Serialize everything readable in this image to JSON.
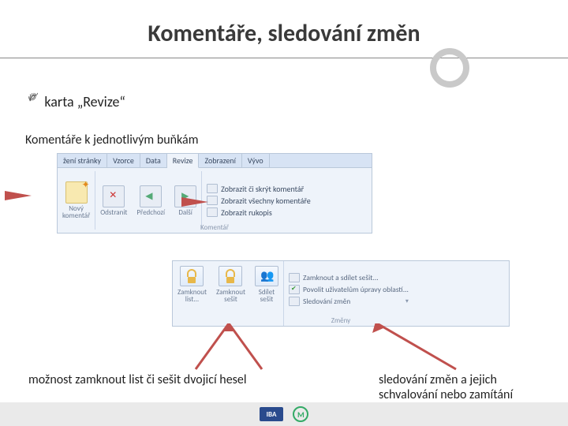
{
  "title": "Komentáře, sledování změn",
  "bullet": "karta „Revize“",
  "subhead": "Komentáře k jednotlivým buňkám",
  "ribbon1": {
    "tabs": [
      "žení stránky",
      "Vzorce",
      "Data",
      "Revize",
      "Zobrazení",
      "Vývo"
    ],
    "active_tab": "Revize",
    "buttons": {
      "new_comment": "Nový\nkomentář",
      "delete": "Odstranit",
      "prev": "Předchozí",
      "next": "Další"
    },
    "stack": {
      "show_hide": "Zobrazit či skrýt komentář",
      "show_all": "Zobrazit všechny komentáře",
      "show_ink": "Zobrazit rukopis"
    },
    "group_label": "Komentář"
  },
  "ribbon2": {
    "buttons": {
      "lock_sheet": "Zamknout\nlist...",
      "lock_book": "Zamknout\nsešit",
      "share_book": "Sdílet\nsešit"
    },
    "rows": {
      "lock_share": "Zamknout a sdílet sešit...",
      "allow_users": "Povolit uživatelům úpravy oblastí...",
      "track_changes": "Sledování změn"
    },
    "group_label": "Změny"
  },
  "caption1": "možnost zamknout list či sešit dvojicí hesel",
  "caption2": "sledování změn a jejich schvalování nebo zamítání",
  "footer": {
    "logo1": "IBA"
  }
}
